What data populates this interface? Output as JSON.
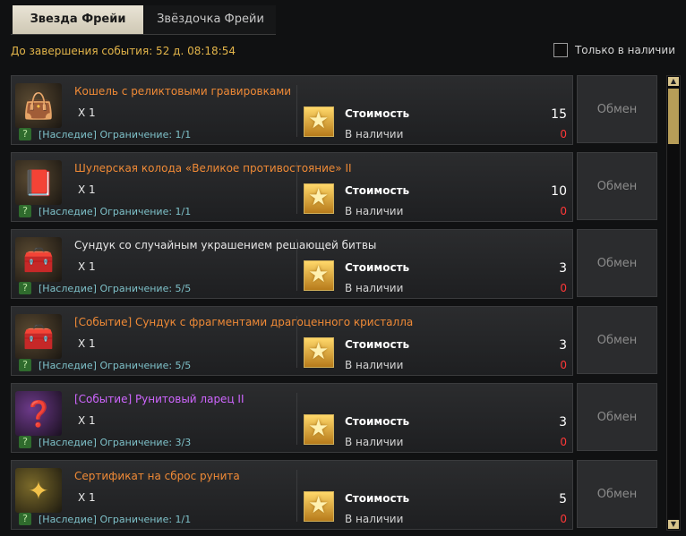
{
  "tabs": [
    {
      "label": "Звезда Фрейи"
    },
    {
      "label": "Звёздочка Фрейи"
    }
  ],
  "event_timer": "До завершения события: 52 д. 08:18:54",
  "only_in_stock_label": "Только в наличии",
  "cost_label": "Стоимость",
  "available_label": "В наличии",
  "exchange_label": "Обмен",
  "items": [
    {
      "name": "Кошель с реликтовыми гравировками",
      "qty": "X 1",
      "limit": "[Наследие] Ограничение: 1/1",
      "cost": "15",
      "available": "0",
      "icon": "bag-icon"
    },
    {
      "name": "Шулерская колода «Великое противостояние» II",
      "qty": "X 1",
      "limit": "[Наследие] Ограничение: 1/1",
      "cost": "10",
      "available": "0",
      "icon": "card-deck-icon"
    },
    {
      "name": "Сундук со случайным украшением решающей битвы",
      "qty": "X 1",
      "limit": "[Наследие] Ограничение: 5/5",
      "cost": "3",
      "available": "0",
      "icon": "chest-icon"
    },
    {
      "name": "[Событие] Сундук с фрагментами драгоценного кристалла",
      "qty": "X 1",
      "limit": "[Наследие] Ограничение: 5/5",
      "cost": "3",
      "available": "0",
      "icon": "chest-icon"
    },
    {
      "name": "[Событие] Рунитовый ларец II",
      "qty": "X 1",
      "limit": "[Наследие] Ограничение: 3/3",
      "cost": "3",
      "available": "0",
      "icon": "rune-box-icon"
    },
    {
      "name": "Сертификат на сброс рунита",
      "qty": "X 1",
      "limit": "[Наследие] Ограничение: 1/1",
      "cost": "5",
      "available": "0",
      "icon": "certificate-icon"
    }
  ],
  "colors": {
    "name_orange": "#f08a36",
    "name_purple": "#cf66ff",
    "timer": "#e3b54a",
    "available_zero": "#ff3838"
  }
}
